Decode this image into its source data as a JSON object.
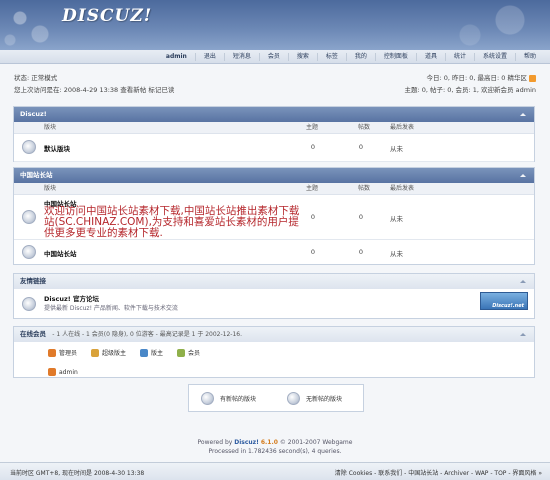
{
  "header": {
    "logo": "DISCUZ!"
  },
  "nav": {
    "items": [
      "admin",
      "退出",
      "短消息",
      "会员",
      "搜索",
      "标签",
      "我的",
      "控制面板",
      "道具",
      "统计",
      "系统设置",
      "帮助"
    ]
  },
  "status": {
    "line1": "状态: 正常模式",
    "line2": "您上次访问是在: 2008-4-29 13:38 查看新帖  标记已读",
    "right1": "今日: 0, 昨日: 0, 最高日: 0  精华区",
    "right2": "主题: 0, 帖子: 0, 会员: 1, 欢迎新会员 admin"
  },
  "columns": {
    "forum": "版块",
    "topics": "主题",
    "posts": "帖数",
    "last": "最后发表"
  },
  "discuz_section": {
    "title": "Discuz!",
    "rows": [
      {
        "name": "默认版块",
        "topics": "0",
        "posts": "0",
        "last": "从未"
      }
    ]
  },
  "china_section": {
    "title": "中国站长站",
    "rows": [
      {
        "name": "中国站长站",
        "topics": "0",
        "posts": "0",
        "last": "从未"
      },
      {
        "name": "中国站长站",
        "topics": "0",
        "posts": "0",
        "last": "从未"
      }
    ],
    "overlay": "欢迎访问中国站长站素材下载,中国站长站推出素材下载站(SC.CHINAZ.COM),为支持和喜爱站长素材的用户提供更多更专业的素材下载."
  },
  "friends": {
    "title": "友情链接",
    "link_title": "Discuz! 官方论坛",
    "link_desc": "提供最新 Discuz! 产品新闻、软件下载与技术交流",
    "banner": "Discuz!.net"
  },
  "online": {
    "title": "在线会员",
    "meta": "- 1 人在线 - 1 会员(0 隐身), 0 位游客 - 最高记录是 1 于 2002-12-16.",
    "legend": [
      "管理员",
      "超级版主",
      "版主",
      "会员"
    ],
    "user": "admin",
    "colors": [
      "#e07a2a",
      "#d9a23a",
      "#4a88c8",
      "#8fb04a"
    ]
  },
  "icon_legend": {
    "new": "有新帖的版块",
    "nonew": "无新帖的版块"
  },
  "powered": {
    "prefix": "Powered by",
    "product": "Discuz!",
    "version": "6.1.0",
    "suffix": "© 2001-2007 Webgame",
    "processed": "Processed in 1.782436 second(s), 4 queries."
  },
  "footer": {
    "left": "当前时区 GMT+8, 现在时间是 2008-4-30 13:38",
    "links": [
      "清除 Cookies",
      "联系我们",
      "中国站长站",
      "Archiver",
      "WAP",
      "TOP",
      "界面风格 »"
    ]
  }
}
